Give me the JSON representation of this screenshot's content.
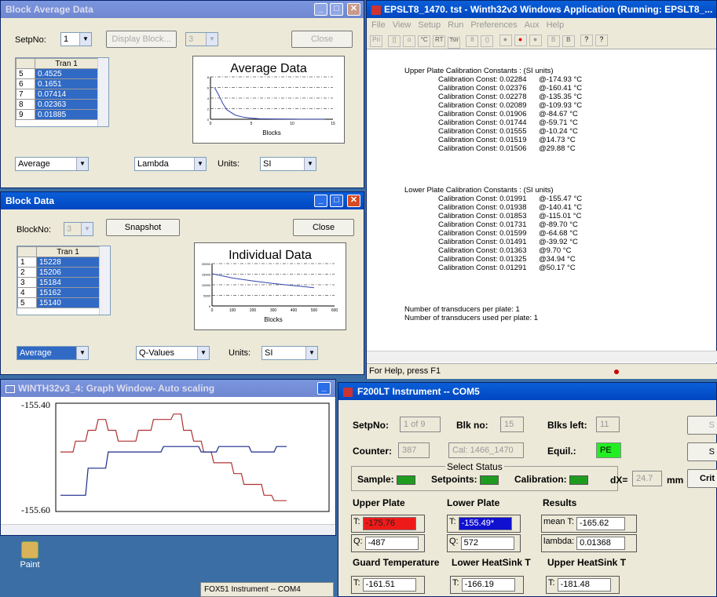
{
  "block_avg": {
    "title": "Block Average Data",
    "setpno_label": "SetpNo:",
    "setpno_value": "1",
    "display_block": "Display Block...",
    "block_combo": "3",
    "close": "Close",
    "grid_header": "Tran 1",
    "rows": [
      {
        "n": "5",
        "v": "0.4525"
      },
      {
        "n": "6",
        "v": "0.1651"
      },
      {
        "n": "7",
        "v": "0.07414"
      },
      {
        "n": "8",
        "v": "0.02363"
      },
      {
        "n": "9",
        "v": "0.01885"
      }
    ],
    "avg_mode": "Average",
    "quantity": "Lambda",
    "units_label": "Units:",
    "units": "SI"
  },
  "block_data": {
    "title": "Block Data",
    "blockno_label": "BlockNo:",
    "blockno_value": "3",
    "snapshot": "Snapshot",
    "close": "Close",
    "grid_header": "Tran 1",
    "rows": [
      {
        "n": "1",
        "v": "15228"
      },
      {
        "n": "2",
        "v": "15206"
      },
      {
        "n": "3",
        "v": "15184"
      },
      {
        "n": "4",
        "v": "15162"
      },
      {
        "n": "5",
        "v": "15140"
      }
    ],
    "avg_mode": "Average",
    "quantity": "Q-Values",
    "units_label": "Units:",
    "units": "SI"
  },
  "chart_data": [
    {
      "type": "line",
      "title": "Average Data",
      "xlabel": "Blocks",
      "ylabel": "",
      "xlim": [
        0,
        15
      ],
      "ylim": [
        0,
        8
      ],
      "x_ticks": [
        "0",
        "5",
        "10",
        "15"
      ],
      "y_ticks": [
        "0",
        "2",
        "4",
        "6",
        "8"
      ],
      "series": [
        {
          "x": [
            0.5,
            1,
            1.5,
            2,
            3,
            4,
            5,
            6,
            8,
            10,
            12,
            14
          ],
          "values": [
            6.0,
            4.6,
            3.0,
            1.8,
            0.8,
            0.4,
            0.2,
            0.1,
            0.05,
            0.03,
            0.02,
            0.02
          ]
        }
      ]
    },
    {
      "type": "line",
      "title": "Individual Data",
      "xlabel": "Blocks",
      "ylabel": "",
      "xlim": [
        0,
        600
      ],
      "ylim": [
        0,
        20000
      ],
      "x_ticks": [
        "0",
        "100",
        "200",
        "300",
        "400",
        "500",
        "600"
      ],
      "y_ticks": [
        "0",
        "5000",
        "10000",
        "15000",
        "20000"
      ],
      "series": [
        {
          "x": [
            0,
            50,
            100,
            200,
            300,
            400,
            500
          ],
          "values": [
            15200,
            14200,
            13200,
            11800,
            10600,
            9600,
            8600
          ]
        }
      ]
    },
    {
      "type": "line",
      "title": "",
      "xlabel": "",
      "ylabel": "",
      "ylim": [
        -155.6,
        -155.4
      ],
      "y_ticks": [
        "-155.40",
        "-155.60"
      ],
      "series": [
        {
          "color": "#b03030",
          "x": [
            0,
            5,
            6,
            10,
            11,
            14,
            15,
            18,
            19,
            22,
            23,
            30,
            31,
            36,
            37,
            44,
            45,
            48,
            49,
            52,
            53,
            56,
            57,
            60,
            61,
            68,
            69,
            72,
            73,
            80,
            81,
            84,
            85,
            90
          ],
          "values": [
            -155.49,
            -155.49,
            -155.47,
            -155.47,
            -155.45,
            -155.45,
            -155.43,
            -155.43,
            -155.45,
            -155.45,
            -155.47,
            -155.47,
            -155.45,
            -155.45,
            -155.43,
            -155.43,
            -155.42,
            -155.42,
            -155.45,
            -155.45,
            -155.47,
            -155.47,
            -155.49,
            -155.49,
            -155.51,
            -155.51,
            -155.53,
            -155.53,
            -155.55,
            -155.55,
            -155.57,
            -155.57,
            -155.58,
            -155.58
          ]
        },
        {
          "color": "#1a2a8a",
          "x": [
            0,
            10,
            11,
            18,
            19,
            40,
            41,
            55,
            56,
            62,
            63,
            75,
            76,
            85,
            86,
            90
          ],
          "values": [
            -155.57,
            -155.57,
            -155.52,
            -155.52,
            -155.49,
            -155.49,
            -155.48,
            -155.48,
            -155.49,
            -155.49,
            -155.48,
            -155.48,
            -155.49,
            -155.49,
            -155.48,
            -155.48
          ]
        }
      ]
    }
  ],
  "winth": {
    "title": "EPSLT8_1470. tst - Winth32v3 Windows Application (Running: EPSLT8_...",
    "menu": [
      "File",
      "View",
      "Setup",
      "Run",
      "Preferences",
      "Aux",
      "Help"
    ],
    "toolbar": [
      "Pri",
      "[]",
      "o",
      "°C",
      "RT",
      "Tstr",
      "8",
      "()",
      "●",
      "●",
      "●",
      "B",
      "B",
      "?",
      "?"
    ],
    "upper_heading": "Upper Plate Calibration Constants  :  (SI units)",
    "upper": [
      {
        "c": "Calibration Const: 0.02284",
        "t": "@-174.93 °C"
      },
      {
        "c": "Calibration Const: 0.02376",
        "t": "@-160.41 °C"
      },
      {
        "c": "Calibration Const: 0.02278",
        "t": "@-135.35 °C"
      },
      {
        "c": "Calibration Const: 0.02089",
        "t": "@-109.93 °C"
      },
      {
        "c": "Calibration Const: 0.01906",
        "t": "@-84.67 °C"
      },
      {
        "c": "Calibration Const: 0.01744",
        "t": "@-59.71 °C"
      },
      {
        "c": "Calibration Const: 0.01555",
        "t": "@-10.24 °C"
      },
      {
        "c": "Calibration Const: 0.01519",
        "t": "@14.73 °C"
      },
      {
        "c": "Calibration Const: 0.01506",
        "t": "@29.88 °C"
      }
    ],
    "lower_heading": "Lower Plate Calibration Constants  :  (SI units)",
    "lower": [
      {
        "c": "Calibration Const: 0.01991",
        "t": "@-155.47 °C"
      },
      {
        "c": "Calibration Const: 0.01938",
        "t": "@-140.41 °C"
      },
      {
        "c": "Calibration Const: 0.01853",
        "t": "@-115.01 °C"
      },
      {
        "c": "Calibration Const: 0.01731",
        "t": "@-89.70 °C"
      },
      {
        "c": "Calibration Const: 0.01599",
        "t": "@-64.68 °C"
      },
      {
        "c": "Calibration Const: 0.01491",
        "t": "@-39.92 °C"
      },
      {
        "c": "Calibration Const: 0.01363",
        "t": "@9.70 °C"
      },
      {
        "c": "Calibration Const: 0.01325",
        "t": "@34.94 °C"
      },
      {
        "c": "Calibration Const: 0.01291",
        "t": "@50.17 °C"
      }
    ],
    "ntrans": "Number of transducers per plate:       1",
    "ntrans_used": "Number of transducers used per plate: 1",
    "status": "For Help, press F1"
  },
  "graph": {
    "title": "WINTH32v3_4: Graph Window- Auto scaling"
  },
  "desktop": {
    "paint": "Paint",
    "taskbar_item": "FOX51 Instrument -- COM4"
  },
  "f200": {
    "title": "F200LT Instrument -- COM5",
    "setpno_label": "SetpNo:",
    "setpno": "1 of 9",
    "blkno_label": "Blk no:",
    "blkno": "15",
    "blksleft_label": "Blks left:",
    "blksleft": "11",
    "counter_label": "Counter:",
    "counter": "387",
    "cal": "Cal: 1466_1470",
    "equil_label": "Equil.:",
    "equil": "PE",
    "select_status": "Select Status",
    "sample_label": "Sample:",
    "setpoints_label": "Setpoints:",
    "calibration_label": "Calibration:",
    "dx_label": "dX=",
    "dx": "24.7",
    "dx_unit": "mm",
    "btn1": "S",
    "btn2": "S",
    "btn3": "Crit",
    "upper_plate": "Upper Plate",
    "lower_plate": "Lower Plate",
    "results": "Results",
    "t_label": "T:",
    "q_label": "Q:",
    "upper_t": "-175.76",
    "upper_q": "-487",
    "lower_t": "-155.49*",
    "lower_q": "572",
    "mean_t_label": "mean T:",
    "mean_t": "-165.62",
    "lambda_label": "lambda:",
    "lambda": "0.01368",
    "guard_label": "Guard Temperature",
    "lower_hs_label": "Lower HeatSink T",
    "upper_hs_label": "Upper HeatSink T",
    "guard_t": "-161.51",
    "lower_hs_t": "-166.19",
    "upper_hs_t": "-181.48"
  }
}
